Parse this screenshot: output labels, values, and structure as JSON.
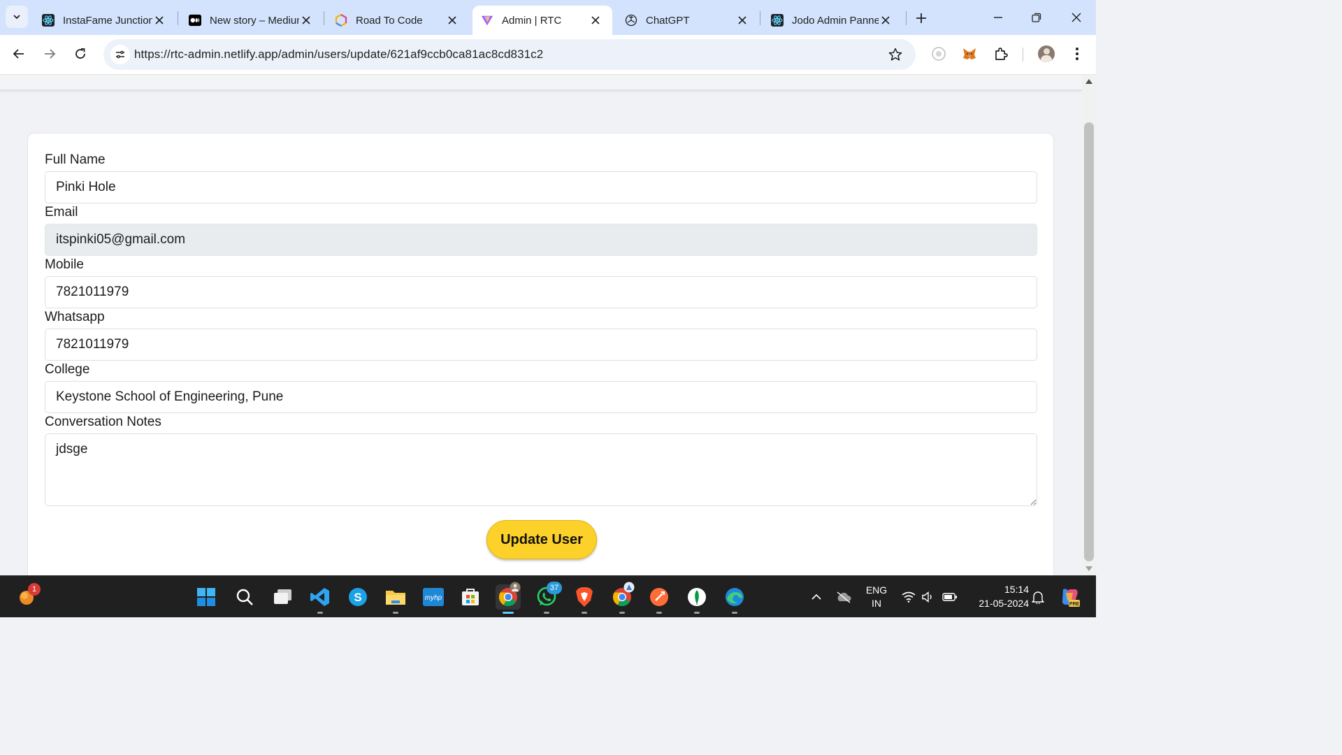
{
  "browser": {
    "tabs": [
      {
        "title": "InstaFame Junction",
        "icon": "react-icon",
        "active": false
      },
      {
        "title": "New story – Medium",
        "icon": "medium-icon",
        "active": false
      },
      {
        "title": "Road To Code",
        "icon": "road-to-code-icon",
        "active": false
      },
      {
        "title": "Admin | RTC",
        "icon": "vite-icon",
        "active": true
      },
      {
        "title": "ChatGPT",
        "icon": "chatgpt-icon",
        "active": false
      },
      {
        "title": "Jodo Admin Panne",
        "icon": "react-icon",
        "active": false
      }
    ],
    "url": "https://rtc-admin.netlify.app/admin/users/update/621af9ccb0ca81ac8cd831c2"
  },
  "form": {
    "full_name_label": "Full Name",
    "full_name_value": "Pinki Hole",
    "email_label": "Email",
    "email_value": "itspinki05@gmail.com",
    "mobile_label": "Mobile",
    "mobile_value": "7821011979",
    "whatsapp_label": "Whatsapp",
    "whatsapp_value": "7821011979",
    "college_label": "College",
    "college_value": "Keystone School of Engineering, Pune",
    "notes_label": "Conversation Notes",
    "notes_value": "jdsge",
    "submit_label": "Update User"
  },
  "taskbar": {
    "notification_badge": "1",
    "whatsapp_badge": "37",
    "language": "ENG",
    "region": "IN",
    "time": "15:14",
    "date": "21-05-2024"
  },
  "colors": {
    "tabstrip": "#d3e3fd",
    "button_accent": "#fcd12a",
    "taskbar": "#202020"
  }
}
